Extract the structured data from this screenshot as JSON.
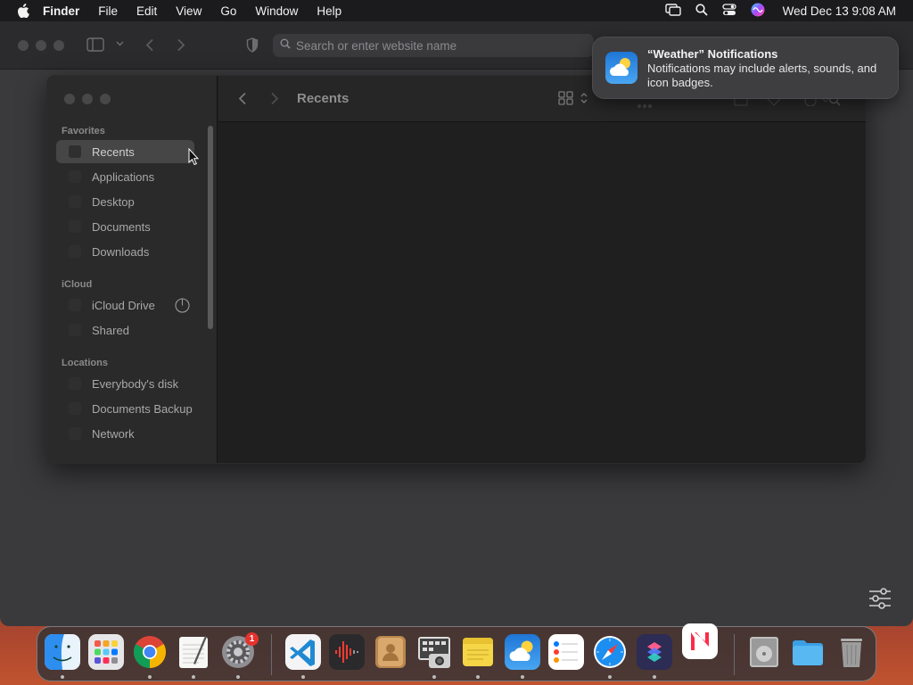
{
  "menubar": {
    "app_name": "Finder",
    "items": [
      "File",
      "Edit",
      "View",
      "Go",
      "Window",
      "Help"
    ],
    "clock": "Wed Dec 13  9:08 AM"
  },
  "safari": {
    "address_placeholder": "Search or enter website name"
  },
  "finder": {
    "title": "Recents",
    "sidebar": {
      "favorites_label": "Favorites",
      "favorites": [
        "Recents",
        "Applications",
        "Desktop",
        "Documents",
        "Downloads"
      ],
      "icloud_label": "iCloud",
      "icloud": [
        "iCloud Drive",
        "Shared"
      ],
      "locations_label": "Locations",
      "locations": [
        "Everybody's disk",
        "Documents Backup",
        "Network"
      ]
    }
  },
  "notification": {
    "title": "“Weather” Notifications",
    "body": "Notifications may include alerts, sounds, and icon badges."
  },
  "dock": {
    "settings_badge": "1"
  }
}
